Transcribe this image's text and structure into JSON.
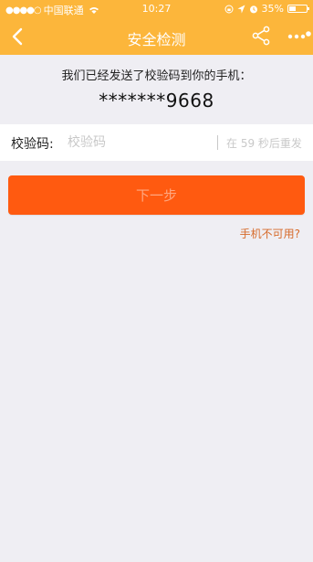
{
  "colors": {
    "header": "#fcb63b",
    "primary_button": "#ff5a10",
    "link": "#d66a2a",
    "background": "#efeef3"
  },
  "status_bar": {
    "signal_dots": "●●●●○",
    "carrier": "中国联通",
    "time": "10:27",
    "battery": "35%"
  },
  "navbar": {
    "back_icon": "chevron-left",
    "title": "安全检测",
    "share_icon": "share",
    "more_icon": "more"
  },
  "notice": "我们已经发送了校验码到你的手机：",
  "phone_masked": "*******9668",
  "code_field": {
    "label": "校验码:",
    "placeholder": "校验码",
    "value": "",
    "resend_text": "在 59 秒后重发"
  },
  "next_button": "下一步",
  "phone_unavailable_link": "手机不可用?"
}
